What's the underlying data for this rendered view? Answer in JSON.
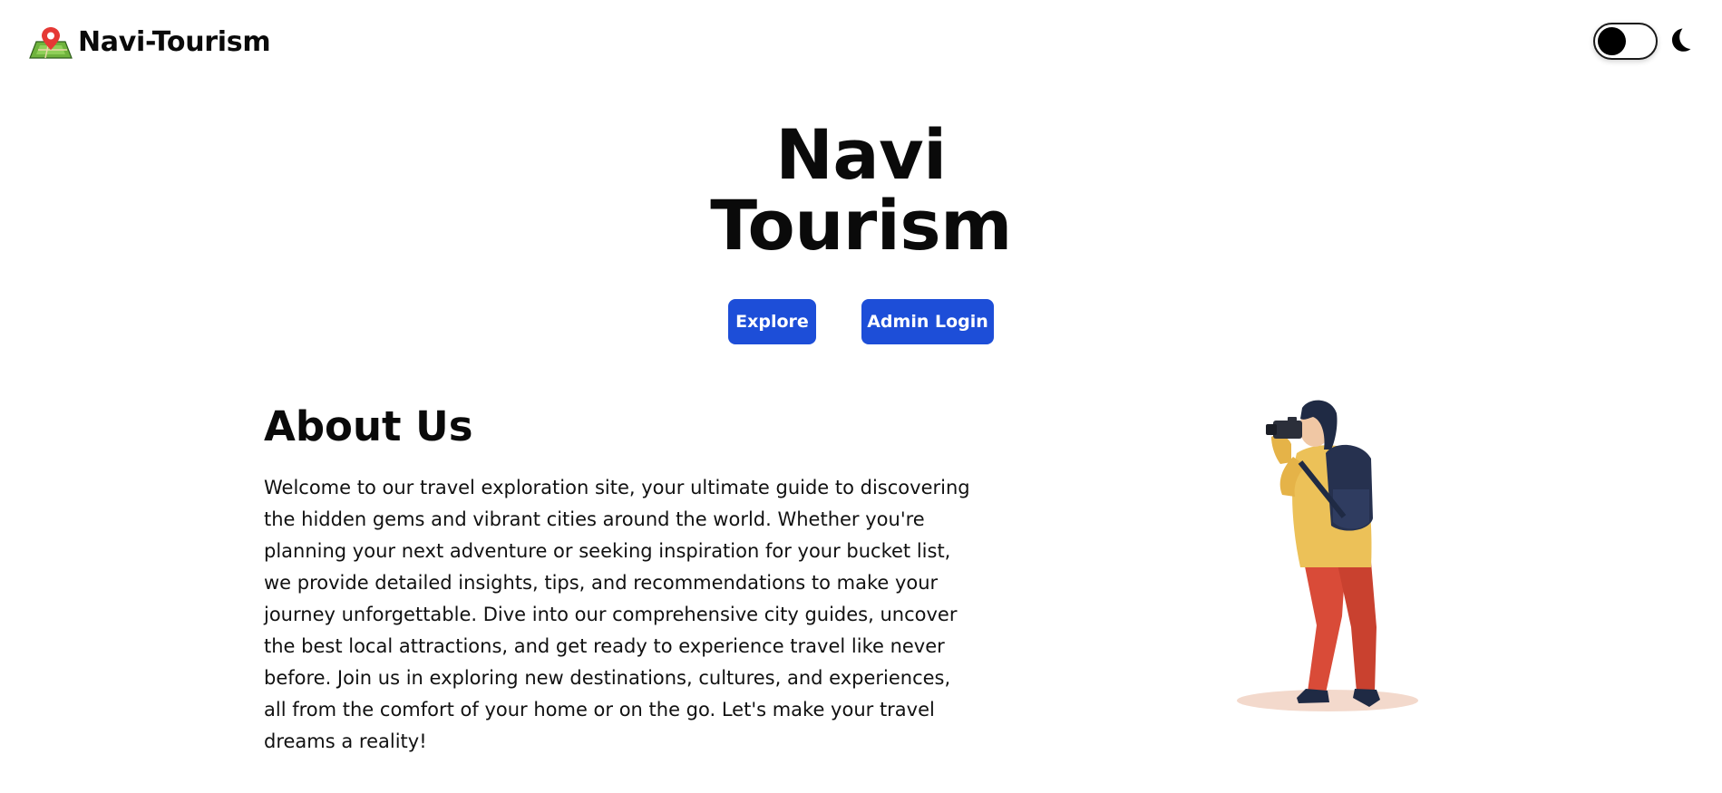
{
  "navbar": {
    "brand_name": "Navi-Tourism",
    "logo_icon": "map-pin-icon",
    "theme_toggle_state": "light",
    "theme_icon": "moon-icon"
  },
  "hero": {
    "title_line1": "Navi",
    "title_line2": "Tourism",
    "explore_label": "Explore",
    "admin_login_label": "Admin Login"
  },
  "about": {
    "heading": "About Us",
    "text": "Welcome to our travel exploration site, your ultimate guide to discovering the hidden gems and vibrant cities around the world. Whether you're planning your next adventure or seeking inspiration for your bucket list, we provide detailed insights, tips, and recommendations to make your journey unforgettable. Dive into our comprehensive city guides, uncover the best local attractions, and get ready to experience travel like never before. Join us in exploring new destinations, cultures, and experiences, all from the comfort of your home or on the go. Let's make your travel dreams a reality!",
    "illustration": "traveler-with-camera-illustration"
  },
  "colors": {
    "button_bg": "#1d4ed8",
    "button_text": "#ffffff",
    "background": "#ffffff",
    "text": "#0a0a0a"
  }
}
